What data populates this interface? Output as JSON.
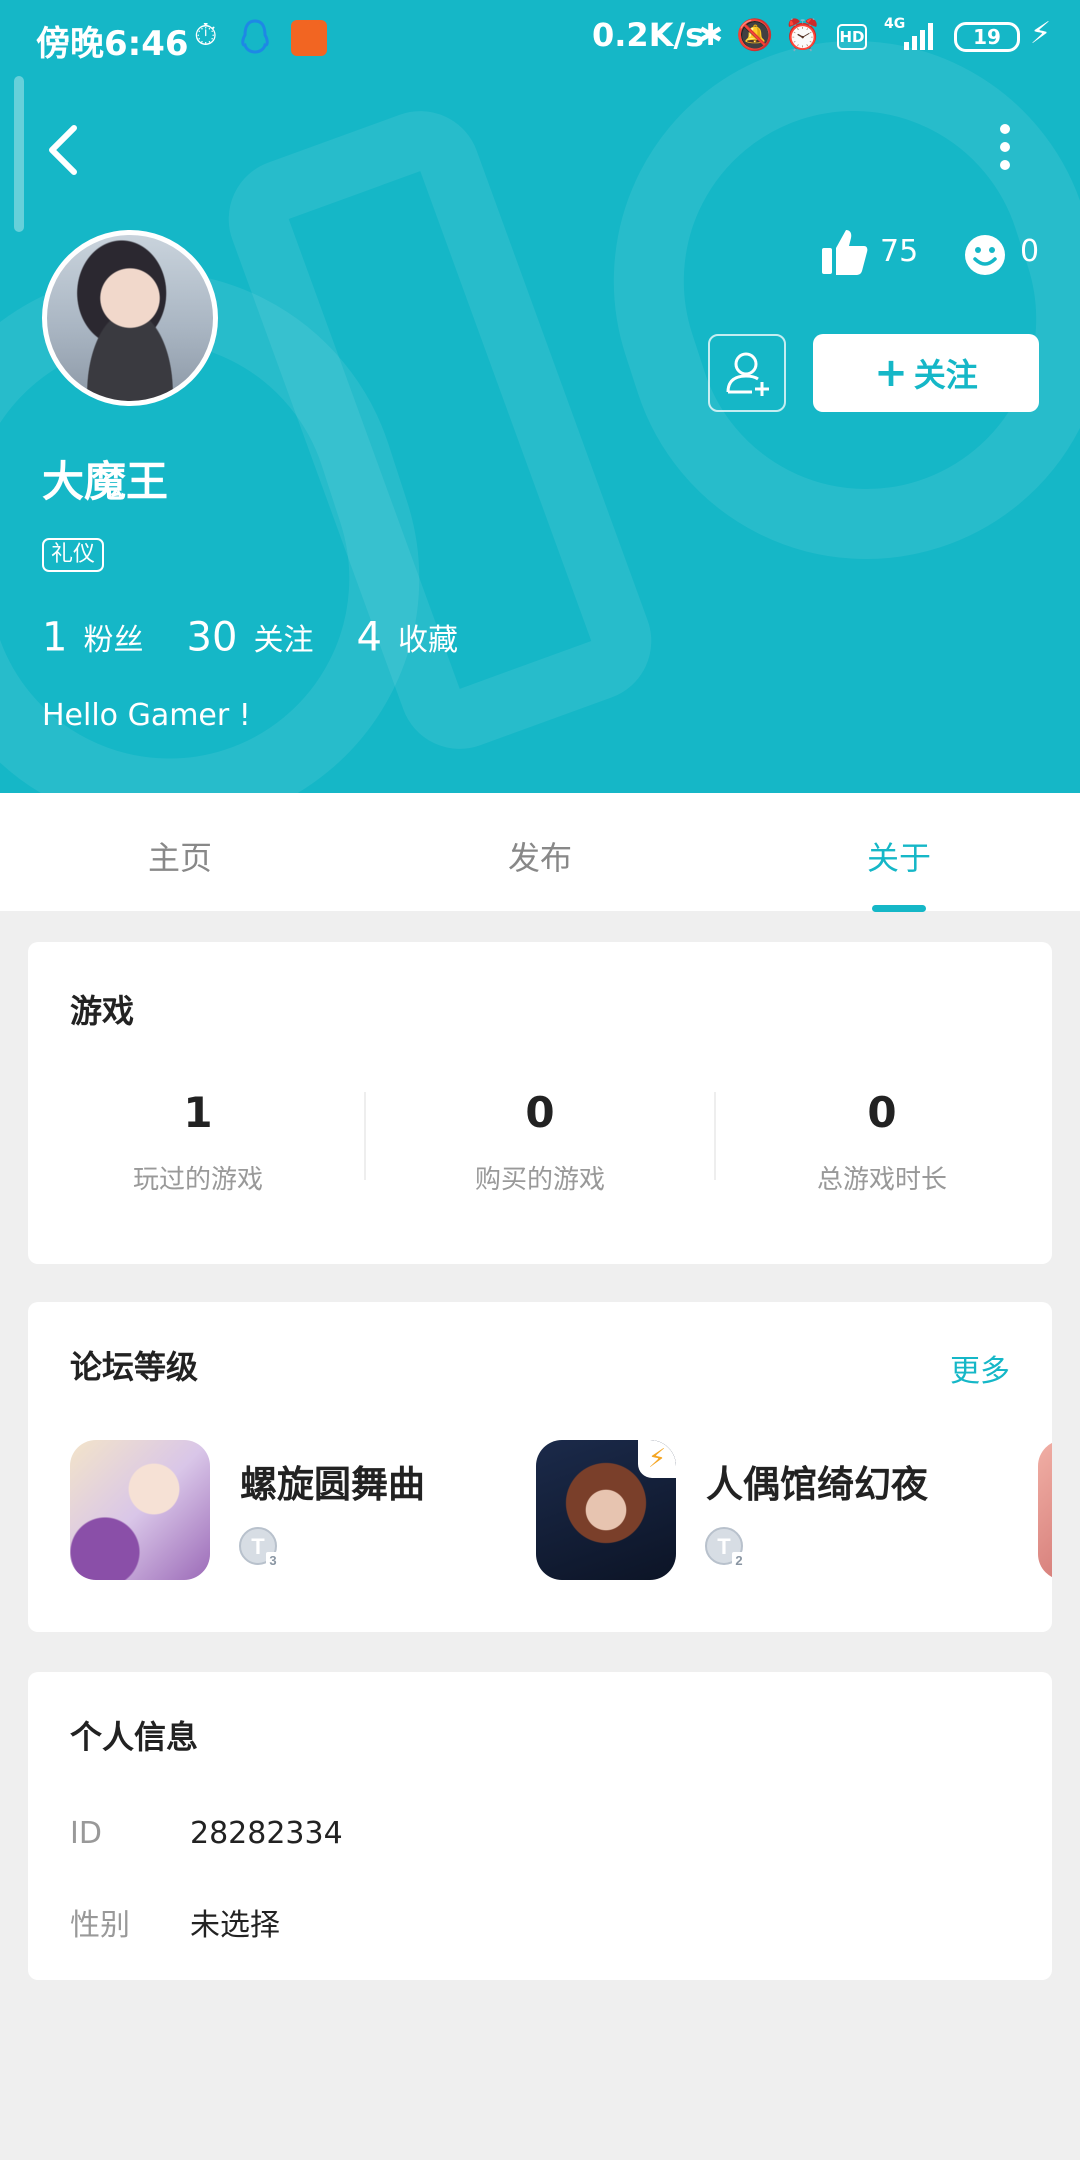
{
  "status_bar": {
    "time": "傍晚6:46",
    "net_speed": "0.2K/s",
    "hd_label": "HD",
    "network_type": "4G",
    "battery": "19"
  },
  "profile": {
    "name": "大魔王",
    "tag": "礼仪",
    "likes": "75",
    "smiles": "0",
    "follow_label": "关注",
    "bio": "Hello Gamer !",
    "stats": [
      {
        "value": "1",
        "label": "粉丝"
      },
      {
        "value": "30",
        "label": "关注"
      },
      {
        "value": "4",
        "label": "收藏"
      }
    ]
  },
  "tabs": [
    {
      "label": "主页",
      "active": false
    },
    {
      "label": "发布",
      "active": false
    },
    {
      "label": "关于",
      "active": true
    }
  ],
  "games": {
    "title": "游戏",
    "stats": [
      {
        "value": "1",
        "label": "玩过的游戏"
      },
      {
        "value": "0",
        "label": "购买的游戏"
      },
      {
        "value": "0",
        "label": "总游戏时长"
      }
    ]
  },
  "forum": {
    "title": "论坛等级",
    "more_label": "更多",
    "items": [
      {
        "name": "螺旋圆舞曲",
        "level": "3"
      },
      {
        "name": "人偶馆绮幻夜",
        "level": "2"
      }
    ]
  },
  "personal_info": {
    "title": "个人信息",
    "rows": [
      {
        "key": "ID",
        "value": "28282334"
      },
      {
        "key": "性别",
        "value": "未选择"
      }
    ]
  },
  "colors": {
    "accent": "#15b7c7",
    "background": "#efefef"
  }
}
